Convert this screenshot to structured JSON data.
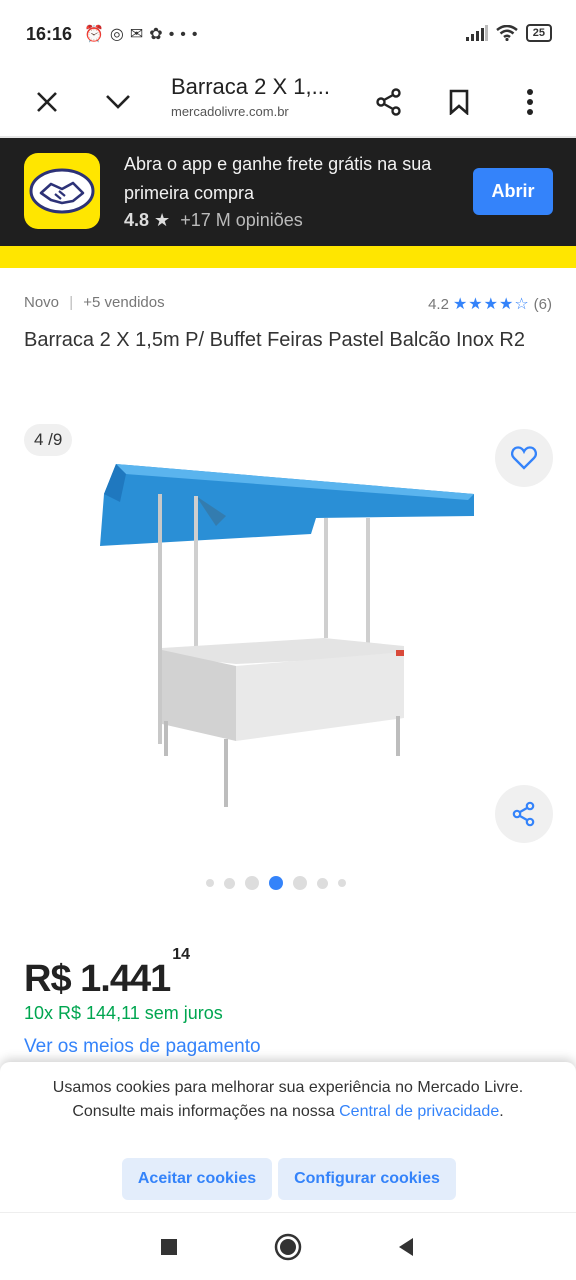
{
  "status_bar": {
    "time": "16:16",
    "left_icons": [
      "alarm-icon",
      "instagram-icon",
      "chat-icon",
      "app-icon",
      "more-dots-icon"
    ],
    "battery": "25"
  },
  "browser": {
    "title": "Barraca 2 X 1,...",
    "url": "mercadolivre.com.br"
  },
  "app_banner": {
    "text": "Abra o app e ganhe frete grátis na sua primeira compra",
    "rating": "4.8",
    "reviews": "+17 M opiniões",
    "open_label": "Abrir"
  },
  "product": {
    "condition": "Novo",
    "separator": "|",
    "sold": "+5 vendidos",
    "rating_value": "4.2",
    "stars": 4.2,
    "review_count": "(6)",
    "title": "Barraca 2 X 1,5m P/ Buffet Feiras Pastel Balcão Inox R2",
    "image_counter": "4 /9",
    "current_image": 4,
    "total_images": 9
  },
  "price": {
    "currency_amount": "R$ 1.441",
    "cents": "14",
    "installments": "10x R$ 144,11 sem juros",
    "payment_link": "Ver os meios de pagamento"
  },
  "cookies": {
    "text": "Usamos cookies para melhorar sua experiência no Mercado Livre. Consulte mais informações na nossa",
    "link": "Central de privacidade",
    "period": ".",
    "accept_label": "Aceitar cookies",
    "configure_label": "Configurar cookies"
  },
  "colors": {
    "accent": "#3483fa",
    "brand_yellow": "#ffe600",
    "installment_green": "#00a650",
    "banner_bg": "#1f1f1f"
  }
}
